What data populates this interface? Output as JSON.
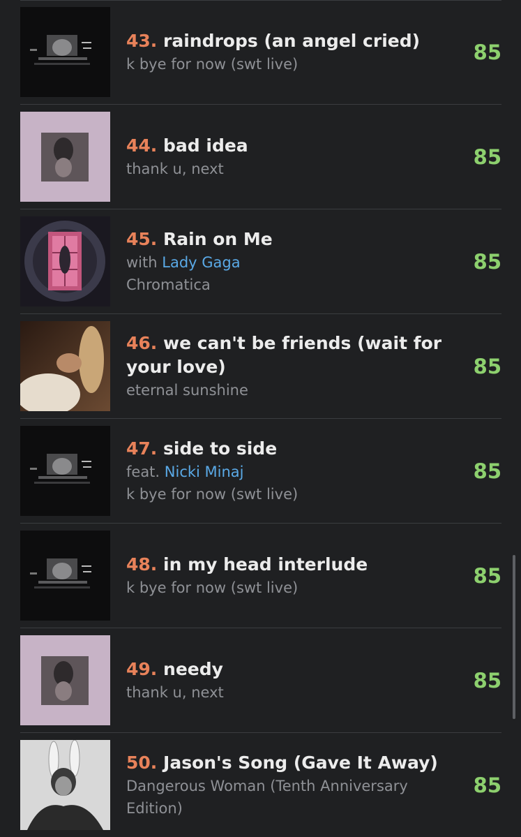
{
  "tracks": [
    {
      "number": "43.",
      "title": "raindrops (an angel cried)",
      "album": "k bye for now (swt live)",
      "score": "85",
      "cover": "k-bye-for-now-cover"
    },
    {
      "number": "44.",
      "title": "bad idea",
      "album": "thank u, next",
      "score": "85",
      "cover": "thank-u-next-cover"
    },
    {
      "number": "45.",
      "title": "Rain on Me",
      "credit_prefix": "with",
      "credit_artist": "Lady Gaga",
      "album": "Chromatica",
      "score": "85",
      "cover": "chromatica-cover"
    },
    {
      "number": "46.",
      "title": "we can't be friends (wait for your love)",
      "album": "eternal sunshine",
      "score": "85",
      "cover": "eternal-sunshine-cover"
    },
    {
      "number": "47.",
      "title": "side to side",
      "credit_prefix": "feat.",
      "credit_artist": "Nicki Minaj",
      "album": "k bye for now (swt live)",
      "score": "85",
      "cover": "k-bye-for-now-cover"
    },
    {
      "number": "48.",
      "title": "in my head interlude",
      "album": "k bye for now (swt live)",
      "score": "85",
      "cover": "k-bye-for-now-cover"
    },
    {
      "number": "49.",
      "title": "needy",
      "album": "thank u, next",
      "score": "85",
      "cover": "thank-u-next-cover"
    },
    {
      "number": "50.",
      "title": "Jason's Song (Gave It Away)",
      "album": "Dangerous Woman (Tenth Anniversary Edition)",
      "score": "85",
      "cover": "dangerous-woman-cover"
    }
  ],
  "colors": {
    "background": "#1f2022",
    "rank": "#e8825a",
    "score": "#8dd06e",
    "link": "#5aa9e6",
    "subtext": "#8f9196"
  }
}
